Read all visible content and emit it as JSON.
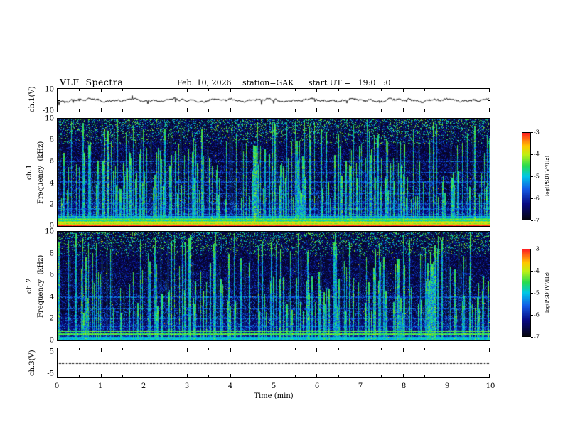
{
  "header": {
    "title": "VLF  Spectra",
    "date": "Feb. 10, 2026",
    "station": "station=GAK",
    "start_ut": "start UT =   19:0   :0"
  },
  "axes": {
    "xlabel": "Time  (min)",
    "x_ticks": [
      0,
      1,
      2,
      3,
      4,
      5,
      6,
      7,
      8,
      9,
      10
    ],
    "ch1_wave": {
      "label": "ch.1(V)",
      "yticks": [
        10,
        -10
      ],
      "ylim": [
        -11,
        11
      ]
    },
    "ch1_spec": {
      "ch_label": "ch.1",
      "axis_label": "Frequency  (kHz)",
      "yticks": [
        10,
        8,
        6,
        4,
        2,
        0
      ],
      "ylim": [
        0,
        10
      ]
    },
    "ch2_spec": {
      "ch_label": "ch.2",
      "axis_label": "Frequency  (kHz)",
      "yticks": [
        10,
        8,
        6,
        4,
        2,
        0
      ],
      "ylim": [
        0,
        10
      ]
    },
    "ch3": {
      "label": "ch.3(V)",
      "yticks": [
        5,
        -5
      ],
      "ylim": [
        -6.5,
        6.5
      ]
    }
  },
  "colorbar": {
    "label": "log(PSD)(V²/Hz)",
    "ticks": [
      -3,
      -4,
      -5,
      -6,
      -7
    ],
    "range": [
      -7,
      -3
    ]
  },
  "colormap": {
    "range": [
      -7,
      -3
    ],
    "stops": [
      [
        0.0,
        [
          5,
          5,
          18
        ]
      ],
      [
        0.18,
        [
          8,
          8,
          130
        ]
      ],
      [
        0.35,
        [
          20,
          90,
          230
        ]
      ],
      [
        0.5,
        [
          0,
          200,
          230
        ]
      ],
      [
        0.62,
        [
          40,
          220,
          80
        ]
      ],
      [
        0.75,
        [
          190,
          240,
          20
        ]
      ],
      [
        0.85,
        [
          255,
          200,
          0
        ]
      ],
      [
        1.0,
        [
          255,
          35,
          35
        ]
      ]
    ]
  },
  "colors": {
    "background": "#ffffff",
    "axis": "#000000",
    "trace": "#000000"
  },
  "chart_data": [
    {
      "type": "line",
      "name": "ch1-waveform",
      "xlabel": "Time (min)",
      "xlim": [
        0,
        10
      ],
      "ylabel": "ch.1(V)",
      "ylim": [
        -11,
        11
      ],
      "yticks": [
        10,
        -10
      ],
      "signal": "broadband noise fluctuating around 0 V, amplitude roughly ±2 V with occasional spikes to ±4 V",
      "seed": 42
    },
    {
      "type": "heatmap",
      "name": "ch1-spectrogram",
      "xlim": [
        0,
        10
      ],
      "xlabel": "Time (min)",
      "ylim": [
        0,
        10
      ],
      "ylabel": "ch.1 Frequency (kHz)",
      "yticks": [
        0,
        2,
        4,
        6,
        8,
        10
      ],
      "value_label": "log(PSD)(V²/Hz)",
      "value_range": [
        -7,
        -3
      ],
      "features": {
        "background_level": -6.9,
        "intense_band_kHz": [
          0,
          0.95
        ],
        "band_peak_level": -3.2,
        "vertical_streaks": 300,
        "streak_level": -4.6,
        "horizontal_lines_kHz": [
          1.05,
          1.6,
          2.1,
          3.0,
          4.1,
          5.0,
          6.0
        ],
        "top_speckle_above_kHz": 7.6
      },
      "seed": 7
    },
    {
      "type": "heatmap",
      "name": "ch2-spectrogram",
      "xlim": [
        0,
        10
      ],
      "xlabel": "Time (min)",
      "ylim": [
        0,
        10
      ],
      "ylabel": "ch.2 Frequency (kHz)",
      "yticks": [
        0,
        2,
        4,
        6,
        8,
        10
      ],
      "value_label": "log(PSD)(V²/Hz)",
      "value_range": [
        -7,
        -3
      ],
      "features": {
        "background_level": -6.9,
        "lines_kHz": [
          0.55,
          0.85
        ],
        "low_band_level": -5.3,
        "vertical_streaks": 260,
        "streak_level": -4.7,
        "horizontal_lines_kHz": [
          1.3,
          2.0,
          2.9,
          4.0,
          5.0,
          6.1
        ],
        "top_speckle_above_kHz": 7.8
      },
      "seed": 19
    },
    {
      "type": "line",
      "name": "ch3-trace",
      "xlabel": "Time (min)",
      "xlim": [
        0,
        10
      ],
      "ylabel": "ch.3(V)",
      "ylim": [
        -6.5,
        6.5
      ],
      "yticks": [
        5,
        -5
      ],
      "signal": "flat dotted trace constant at 0 V",
      "seed": 3
    }
  ]
}
